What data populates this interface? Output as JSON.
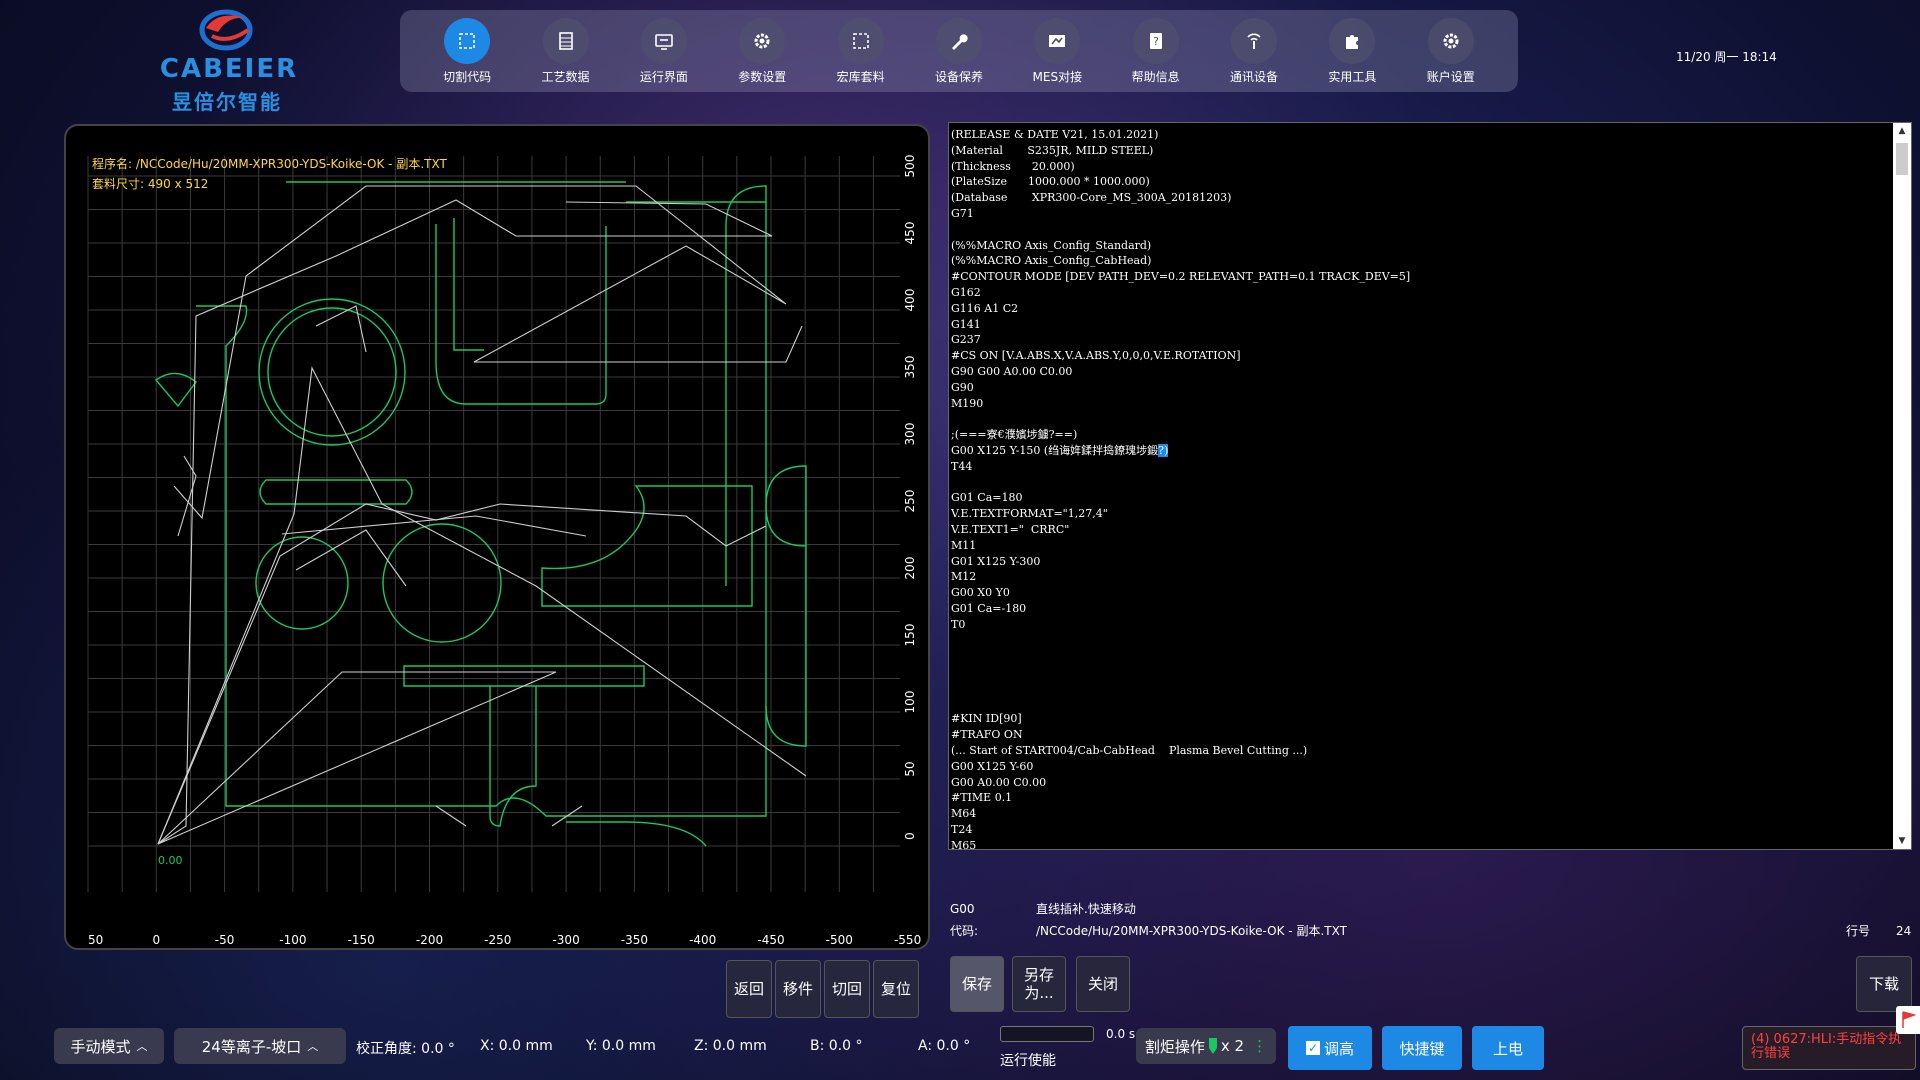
{
  "app": {
    "logo_text": "CABEIER",
    "logo_sub": "昱倍尔智能",
    "clock": "11/20 周一 18:14"
  },
  "toolbar": [
    {
      "label": "切割代码",
      "icon": "cut-code-icon",
      "active": true
    },
    {
      "label": "工艺数据",
      "icon": "process-data-icon"
    },
    {
      "label": "运行界面",
      "icon": "run-screen-icon"
    },
    {
      "label": "参数设置",
      "icon": "gear-icon"
    },
    {
      "label": "宏库套料",
      "icon": "macro-nesting-icon"
    },
    {
      "label": "设备保养",
      "icon": "wrench-icon"
    },
    {
      "label": "MES对接",
      "icon": "mes-icon"
    },
    {
      "label": "帮助信息",
      "icon": "help-icon"
    },
    {
      "label": "通讯设备",
      "icon": "antenna-icon"
    },
    {
      "label": "实用工具",
      "icon": "puzzle-icon"
    },
    {
      "label": "账户设置",
      "icon": "gear-icon"
    }
  ],
  "plot": {
    "program_name": "程序名: /NCCode/Hu/20MM-XPR300-YDS-Koike-OK - 副本.TXT",
    "nest_size": "套料尺寸: 490 x 512",
    "origin_label": "0.00",
    "x_ticks": [
      "50",
      "0",
      "-50",
      "-100",
      "-150",
      "-200",
      "-250",
      "-300",
      "-350",
      "-400",
      "-450",
      "-500",
      "-550"
    ],
    "y_ticks": [
      "500",
      "450",
      "400",
      "350",
      "300",
      "250",
      "200",
      "150",
      "100",
      "50",
      "0"
    ],
    "grid_color": "#3a3a3a",
    "part_color": "#19c864",
    "traverse_color": "#cfcfcf"
  },
  "code": {
    "before": "(RELEASE & DATE V21, 15.01.2021)\n(Material       S235JR, MILD STEEL)\n(Thickness      20.000)\n(PlateSize      1000.000 * 1000.000)\n(Database       XPR300-Core_MS_300A_20181203)\nG71\n\n(%%MACRO Axis_Config_Standard)\n(%%MACRO Axis_Config_CabHead)\n#CONTOUR MODE [DEV PATH_DEV=0.2 RELEVANT_PATH=0.1 TRACK_DEV=5]\nG162\nG116 A1 C2\nG141\nG237\n#CS ON [V.A.ABS.X,V.A.ABS.Y,0,0,0,V.E.ROTATION]\nG90 G00 A0.00 C0.00\nG90\nM190\n\n;(===寮€濮嬪埗鐪?==)\nG00 X125 Y-150 (绉诲姩鍒拌捣鐐瑰埗鍛",
    "highlight": "?)",
    "after": "\nT44\n\nG01 Ca=180\nV.E.TEXTFORMAT=\"1,27,4\"\nV.E.TEXT1=\"  CRRC\"\nM11\nG01 X125 Y-300\nM12\nG00 X0 Y0\nG01 Ca=-180\nT0\n\n\n\n\n\n#KIN ID[90]\n#TRAFO ON\n(... Start of START004/Cab-CabHead    Plasma Bevel Cutting ...)\nG00 X125 Y-60\nG00 A0.00 C0.00\n#TIME 0.1\nM64\nT24\nM65"
  },
  "gcode_info": {
    "code": "G00",
    "desc": "直线插补.快速移动",
    "path_label": "代码:",
    "path": "/NCCode/Hu/20MM-XPR300-YDS-Koike-OK - 副本.TXT",
    "line_label": "行号",
    "line_value": "24"
  },
  "plot_buttons": [
    "返回",
    "移件",
    "切回",
    "复位"
  ],
  "code_buttons": {
    "save": "保存",
    "save_as": "另存为...",
    "close": "关闭"
  },
  "download_button": "下载",
  "status": {
    "mode": "手动模式",
    "process": "24等离子-坡口",
    "angle": "校正角度: 0.0 °",
    "x": "X: 0.0 mm",
    "y": "Y: 0.0 mm",
    "z": "Z: 0.0 mm",
    "b": "B: 0.0 °",
    "a": "A: 0.0 °",
    "run_time": "0.0 s",
    "run_enable": "运行使能",
    "run_progress": 0,
    "cut_op": "割炬操作",
    "cut_op_count": "x 2",
    "height_adjust": "调高",
    "hotkey": "快捷键",
    "power_on": "上电",
    "alarm": "(4) 0627:HLI:手动指令执行错误"
  }
}
